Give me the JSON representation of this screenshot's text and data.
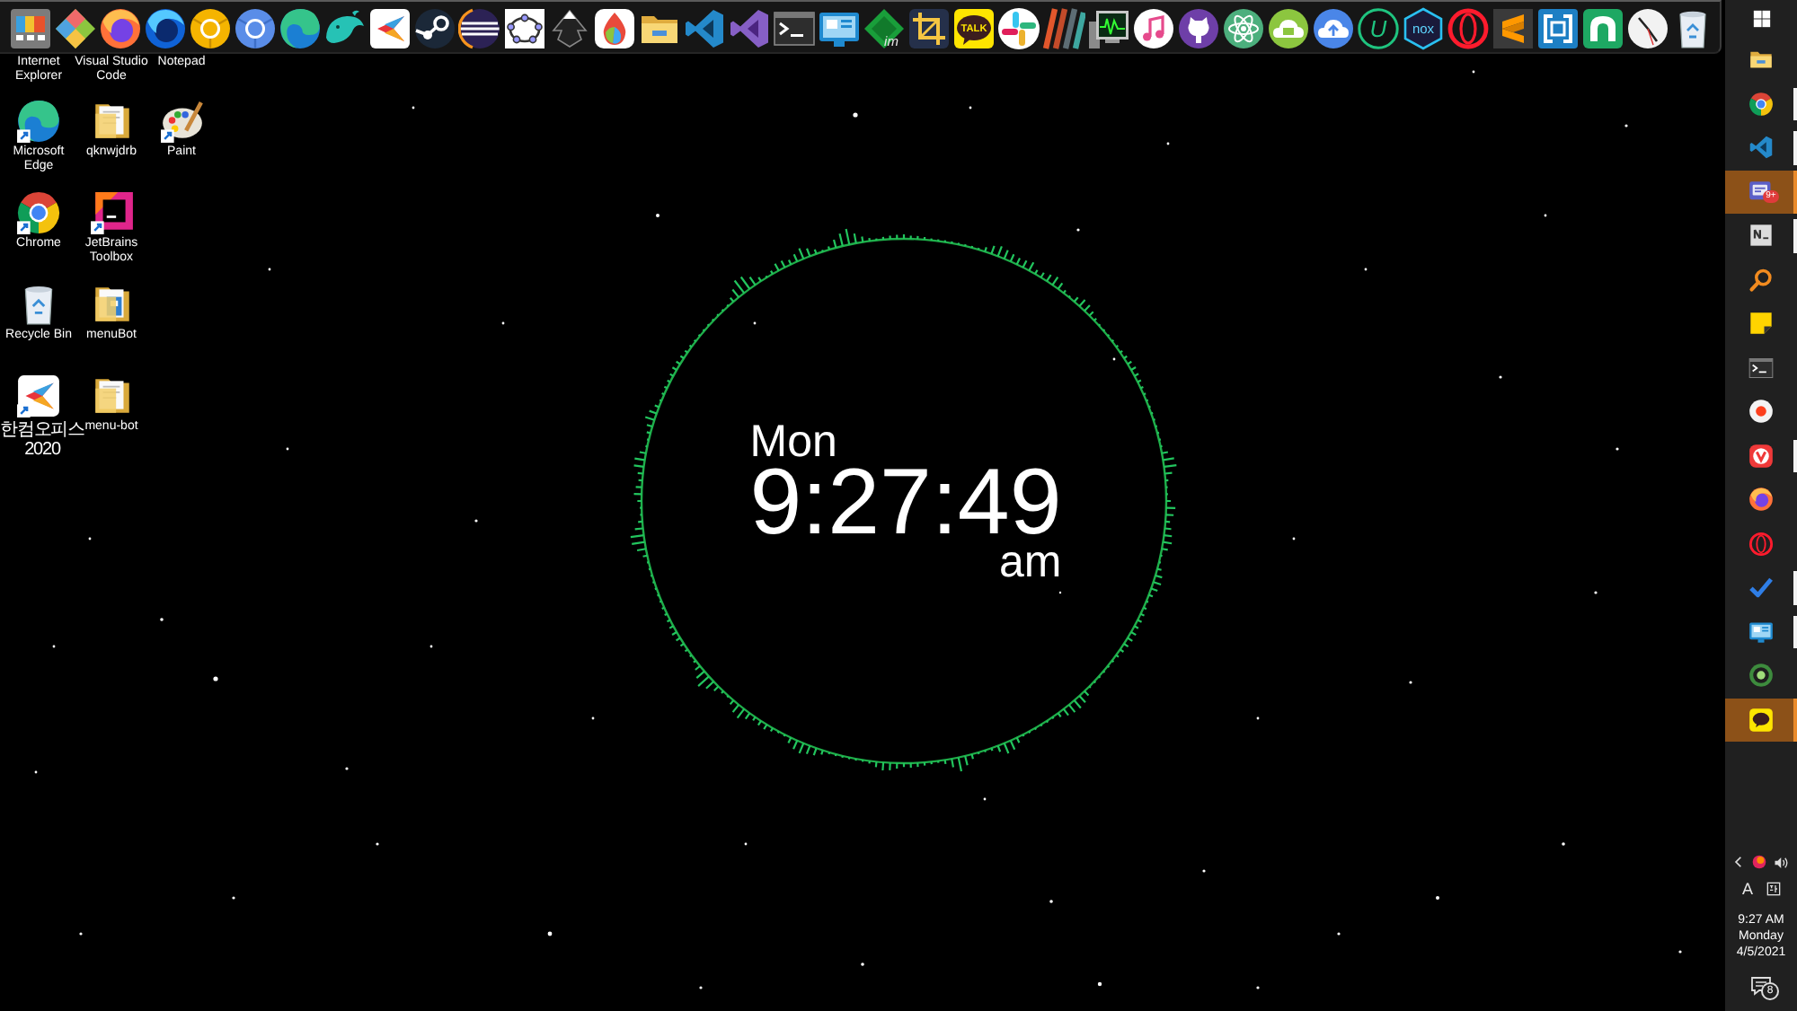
{
  "dock": {
    "icon_texts": [
      "im",
      "TALK",
      "U",
      "nox"
    ]
  },
  "desktop": {
    "shortcuts": [
      {
        "label": "Internet Explorer"
      },
      {
        "label": "Microsoft Edge"
      },
      {
        "label": "Chrome"
      },
      {
        "label": "Recycle Bin"
      },
      {
        "label": "한컴오피스 2020"
      },
      {
        "label": "Visual Studio Code"
      },
      {
        "label": "qknwjdrb"
      },
      {
        "label": "JetBrains Toolbox"
      },
      {
        "label": "menuBot"
      },
      {
        "label": "menu-bot"
      },
      {
        "label": "Notepad"
      },
      {
        "label": "Paint"
      }
    ]
  },
  "clock_widget": {
    "day": "Mon",
    "time": "9:27:49",
    "meridiem": "am"
  },
  "taskbar": {
    "apps": [
      {
        "active": false,
        "running": false
      },
      {
        "active": false,
        "running": true
      },
      {
        "active": false,
        "running": true
      },
      {
        "active": true,
        "running": false,
        "badge": "9+"
      },
      {
        "active": false,
        "running": true
      },
      {
        "active": false,
        "running": false
      },
      {
        "active": false,
        "running": false
      },
      {
        "active": false,
        "running": false
      },
      {
        "active": false,
        "running": false
      },
      {
        "active": false,
        "running": true
      },
      {
        "active": false,
        "running": false
      },
      {
        "active": false,
        "running": false
      },
      {
        "active": false,
        "running": true
      },
      {
        "active": false,
        "running": true
      },
      {
        "active": false,
        "running": false
      },
      {
        "active": true,
        "running": false
      }
    ]
  },
  "tray": {
    "input_mode": "A",
    "time": "9:27 AM",
    "day": "Monday",
    "date": "4/5/2021",
    "notification_count": "8"
  }
}
